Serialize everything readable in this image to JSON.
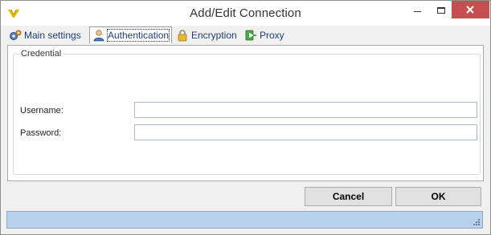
{
  "window": {
    "title": "Add/Edit Connection",
    "app_icon": "v-logo-icon",
    "controls": [
      "minimize-icon",
      "maximize-icon",
      "close-icon"
    ]
  },
  "tabs": [
    {
      "label": "Main settings",
      "icon": "gears-icon",
      "active": false
    },
    {
      "label": "Authentication",
      "icon": "user-icon",
      "active": true
    },
    {
      "label": "Encryption",
      "icon": "padlock-icon",
      "active": false
    },
    {
      "label": "Proxy",
      "icon": "proxy-icon",
      "active": false
    }
  ],
  "credential": {
    "legend": "Credential",
    "username_label": "Username:",
    "username_value": "",
    "password_label": "Password:",
    "password_value": ""
  },
  "buttons": {
    "cancel": "Cancel",
    "ok": "OK"
  },
  "colors": {
    "close_button": "#c74d4e",
    "statusbar": "#b9d1ea",
    "tab_text": "#1f3d74"
  }
}
